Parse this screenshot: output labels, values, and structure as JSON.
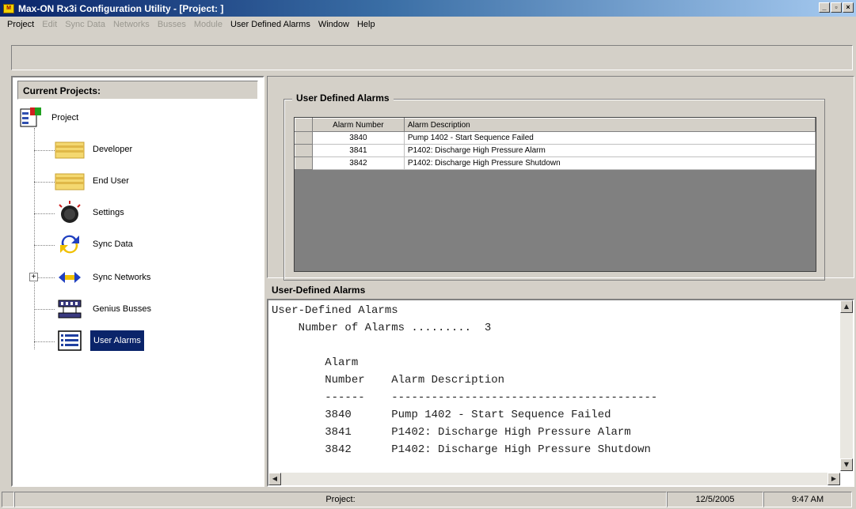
{
  "window": {
    "title": "Max-ON Rx3i Configuration Utility - [Project: ]",
    "controls": [
      "minimize-icon",
      "restore-icon",
      "close-icon"
    ]
  },
  "menu": {
    "items": [
      {
        "label": "Project",
        "enabled": true
      },
      {
        "label": "Edit",
        "enabled": false
      },
      {
        "label": "Sync Data",
        "enabled": false
      },
      {
        "label": "Networks",
        "enabled": false
      },
      {
        "label": "Busses",
        "enabled": false
      },
      {
        "label": "Module",
        "enabled": false
      },
      {
        "label": "User Defined Alarms",
        "enabled": true
      },
      {
        "label": "Window",
        "enabled": true
      },
      {
        "label": "Help",
        "enabled": true
      }
    ]
  },
  "projects_panel": {
    "header": "Current Projects:",
    "root": {
      "label": "Project",
      "icon": "project-icon"
    },
    "items": [
      {
        "label": "Developer",
        "icon": "developer-folder-icon",
        "selected": false
      },
      {
        "label": "End User",
        "icon": "end-user-folder-icon",
        "selected": false
      },
      {
        "label": "Settings",
        "icon": "settings-dial-icon",
        "selected": false
      },
      {
        "label": "Sync Data",
        "icon": "sync-data-icon",
        "selected": false
      },
      {
        "label": "Sync Networks",
        "icon": "sync-networks-icon",
        "selected": false,
        "expander": "+"
      },
      {
        "label": "Genius Busses",
        "icon": "genius-busses-icon",
        "selected": false
      },
      {
        "label": "User Alarms",
        "icon": "user-alarms-list-icon",
        "selected": true
      }
    ]
  },
  "alarms_group": {
    "title": "User Defined Alarms",
    "columns": [
      "Alarm Number",
      "Alarm Description"
    ],
    "rows": [
      {
        "number": "3840",
        "description": "Pump 1402 - Start Sequence Failed"
      },
      {
        "number": "3841",
        "description": "P1402: Discharge High Pressure Alarm"
      },
      {
        "number": "3842",
        "description": "P1402: Discharge High Pressure Shutdown"
      }
    ]
  },
  "report": {
    "header": "User-Defined Alarms",
    "title_line": "User-Defined Alarms",
    "count_line": "Number of Alarms .........  3",
    "col1_head1": "Alarm",
    "col1_head2": "Number",
    "col2_head": "Alarm Description",
    "sep1": "------",
    "sep2": "----------------------------------------",
    "lines": [
      {
        "number": "3840",
        "description": "Pump 1402 - Start Sequence Failed"
      },
      {
        "number": "3841",
        "description": "P1402: Discharge High Pressure Alarm"
      },
      {
        "number": "3842",
        "description": "P1402: Discharge High Pressure Shutdown"
      }
    ]
  },
  "status": {
    "project": "Project:",
    "date": "12/5/2005",
    "time": "9:47 AM"
  }
}
